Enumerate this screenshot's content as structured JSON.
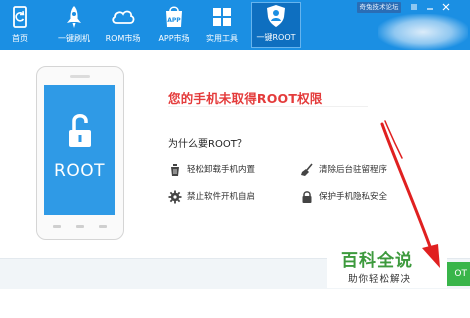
{
  "topbar": {
    "nav": [
      {
        "label": "首页",
        "icon": "refresh-phone-icon",
        "active": false
      },
      {
        "label": "一键刷机",
        "icon": "rocket-icon",
        "active": false
      },
      {
        "label": "ROM市场",
        "icon": "cloud-icon",
        "active": false
      },
      {
        "label": "APP市场",
        "icon": "app-bag-icon",
        "active": false
      },
      {
        "label": "实用工具",
        "icon": "grid-icon",
        "active": false
      },
      {
        "label": "一键ROOT",
        "icon": "shield-person-icon",
        "active": true
      }
    ],
    "forum_label": "奇兔技术论坛",
    "window_controls": [
      "menu-icon",
      "minimize-icon",
      "close-icon"
    ]
  },
  "phone": {
    "screen_text": "ROOT",
    "icon": "unlocked-padlock-icon"
  },
  "content": {
    "headline": "您的手机未取得ROOT权限",
    "why_title": "为什么要ROOT？",
    "features": [
      {
        "label": "轻松卸载手机内置",
        "icon": "trash-bottle-icon"
      },
      {
        "label": "清除后台驻留程序",
        "icon": "broom-icon"
      },
      {
        "label": "禁止软件开机自启",
        "icon": "gear-icon"
      },
      {
        "label": "保护手机隐私安全",
        "icon": "lock-icon"
      }
    ]
  },
  "action": {
    "button_label": "OT"
  },
  "watermark": {
    "title": "百科全说",
    "subtitle": "助你轻松解决"
  },
  "colors": {
    "topbar": "#1b8fe3",
    "headline": "#e43b3b",
    "phone_screen": "#2f9ae6",
    "button": "#39b54a",
    "watermark": "#3d9a3d",
    "arrow": "#e02020"
  }
}
